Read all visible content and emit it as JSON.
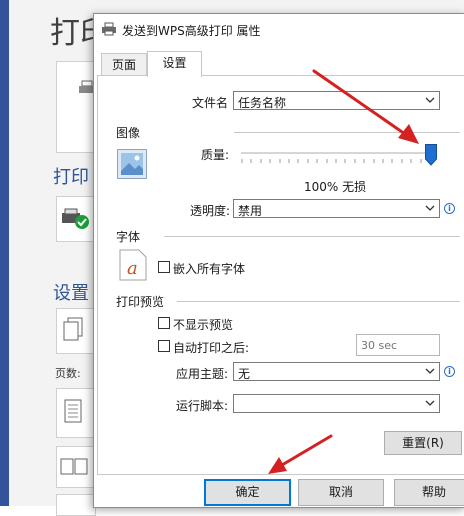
{
  "background": {
    "heading": "打印",
    "section_print": "打印",
    "section_settings": "设置",
    "pages_label": "页数:"
  },
  "dialog": {
    "title": "发送到WPS高级打印 属性",
    "tabs": [
      {
        "label": "页面",
        "active": false
      },
      {
        "label": "设置",
        "active": true
      }
    ]
  },
  "settings": {
    "filename_label": "文件名",
    "filename_value": "任务名称",
    "image_section": "图像",
    "quality_label": "质量:",
    "quality_value": "100% 无损",
    "quality_slider_fraction": 1.0,
    "transparency_label": "透明度:",
    "transparency_value": "禁用",
    "font_section": "字体",
    "embed_fonts_label": "嵌入所有字体",
    "embed_fonts_checked": false,
    "preview_section": "打印预览",
    "hide_preview_label": "不显示预览",
    "hide_preview_checked": false,
    "auto_print_label": "自动打印之后:",
    "auto_print_checked": false,
    "auto_print_placeholder": "30 sec",
    "theme_label": "应用主题:",
    "theme_value": "无",
    "script_label": "运行脚本:",
    "script_value": "",
    "reset_button": "重置(R)"
  },
  "footer": {
    "ok": "确定",
    "cancel": "取消",
    "help": "帮助"
  },
  "colors": {
    "accent": "#0078d7",
    "slider_thumb": "#1e6fd1",
    "arrow": "#d42121"
  }
}
